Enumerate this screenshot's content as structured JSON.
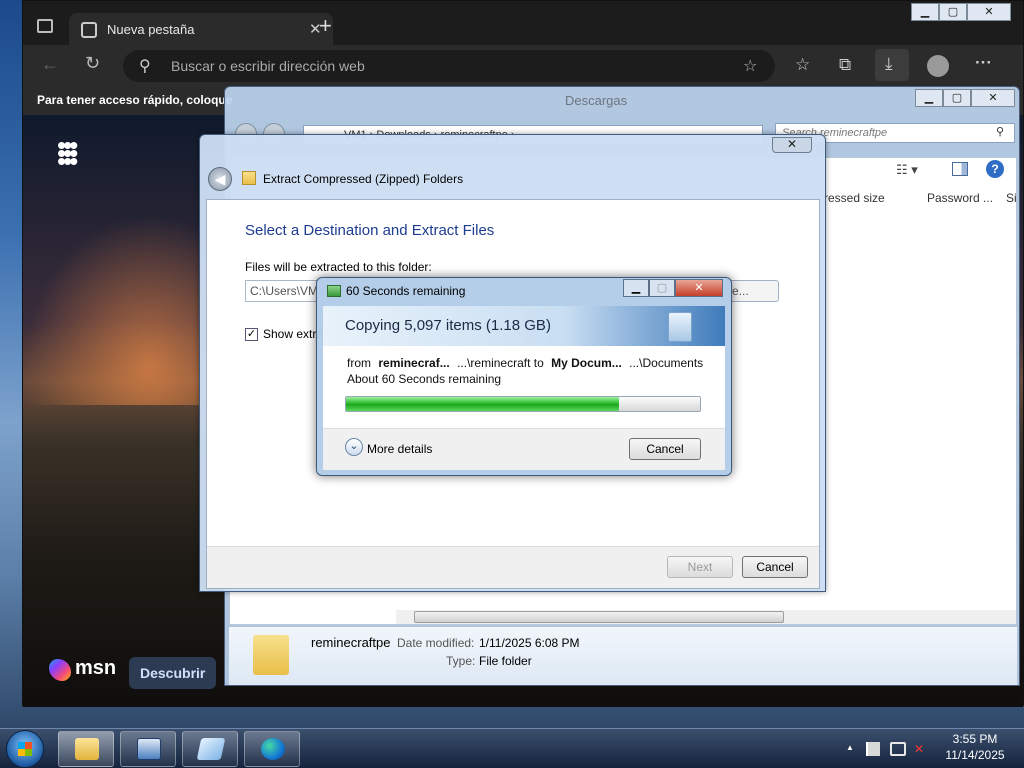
{
  "colors": {
    "progress_green": "#22b522",
    "heading_blue": "#1e3d8f",
    "edge_dark": "#202124"
  },
  "edge": {
    "tab_title": "Nueva pestaña",
    "tab_close": "✕",
    "new_tab": "+",
    "address_placeholder": "Buscar o escribir dirección web",
    "favorites_hint": "Para tener acceso rápido, coloque",
    "msn_logo": "msn",
    "discover_button": "Descubrir",
    "window_min": "▁",
    "window_max": "▢",
    "window_close": "✕"
  },
  "explorer": {
    "title": "Descargas",
    "address_path": "VM1 › Downloads › reminecraftpe ›",
    "search_placeholder": "Search reminecraftpe",
    "col_compressed_size": "ressed size",
    "col_password": "Password ...",
    "col_size": "Si",
    "window_min": "▁",
    "window_max": "▢",
    "window_close": "✕",
    "details": {
      "name": "reminecraftpe",
      "date_label": "Date modified:",
      "date_value": "1/11/2025 6:08 PM",
      "type_label": "Type:",
      "type_value": "File folder"
    }
  },
  "wizard": {
    "title": "Extract Compressed (Zipped) Folders",
    "close": "✕",
    "back_arrow": "◀",
    "heading": "Select a Destination and Extract Files",
    "folder_label": "Files will be extracted to this folder:",
    "path_value": "C:\\Users\\VM",
    "browse_label": "se...",
    "show_checkbox_mark": "✓",
    "show_label": "Show extra",
    "next_button": "Next",
    "cancel_button": "Cancel"
  },
  "copy": {
    "title": "60 Seconds remaining",
    "min": "▁",
    "max": "▢",
    "close": "✕",
    "heading": "Copying 5,097 items (1.18 GB)",
    "from_word": "from",
    "from_bold": "reminecraf...",
    "from_path": "...\\reminecraft to",
    "to_bold": "My Docum...",
    "to_path": "...\\Documents",
    "remaining": "About 60 Seconds remaining",
    "progress_fraction": 0.77,
    "more_details": "More details",
    "more_chevron": "⌄",
    "cancel_button": "Cancel"
  },
  "taskbar": {
    "time": "3:55 PM",
    "date": "11/14/2025",
    "tray_up": "▲"
  }
}
